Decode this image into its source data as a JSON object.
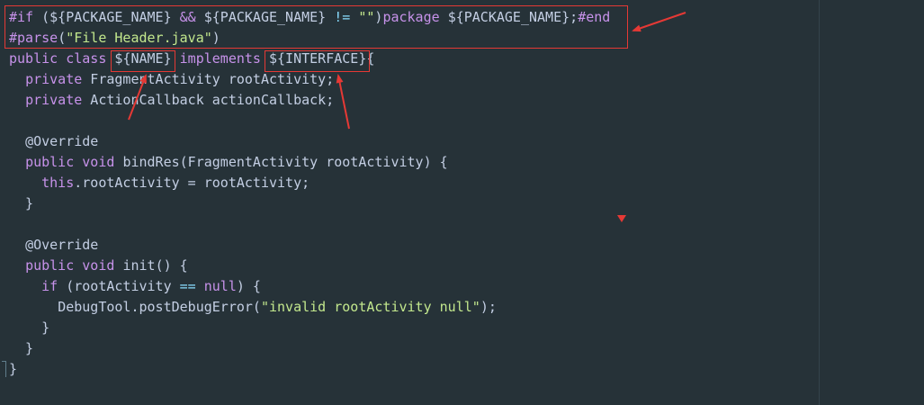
{
  "code": {
    "line1": {
      "if": "#if",
      "open": " (",
      "pkg1": "${PACKAGE_NAME}",
      "and": " && ",
      "pkg2": "${PACKAGE_NAME}",
      "neq": " != ",
      "empty": "\"\"",
      "close": ")",
      "package": "package",
      "sp": " ",
      "pkg3": "${PACKAGE_NAME}",
      "semi": ";",
      "end": "#end"
    },
    "line2": {
      "parse": "#parse",
      "open": "(",
      "arg": "\"File Header.java\"",
      "close": ")"
    },
    "line3": {
      "public": "public",
      "class": " class ",
      "name": "${NAME}",
      "implements": " implements ",
      "iface": "${INTERFACE}",
      "brace": "{"
    },
    "line4": {
      "indent": "  ",
      "private": "private",
      "type": " FragmentActivity ",
      "field": "rootActivity",
      "semi": ";"
    },
    "line5": {
      "indent": "  ",
      "private": "private",
      "type": " ActionCallback ",
      "field": "actionCallback",
      "semi": ";"
    },
    "line7": {
      "indent": "  ",
      "ann": "@Override"
    },
    "line8": {
      "indent": "  ",
      "public": "public",
      "void": " void ",
      "name": "bindRes",
      "params": "(FragmentActivity rootActivity) {"
    },
    "line9": {
      "indent": "    ",
      "this": "this",
      "rest": ".rootActivity = rootActivity;"
    },
    "line10": {
      "text": "  }"
    },
    "line12": {
      "indent": "  ",
      "ann": "@Override"
    },
    "line13": {
      "indent": "  ",
      "public": "public",
      "void": " void ",
      "name": "init",
      "params": "() {"
    },
    "line14": {
      "indent": "    ",
      "if": "if",
      "open": " (rootActivity ",
      "eq": "==",
      "sp": " ",
      "null": "null",
      "close": ") {"
    },
    "line15": {
      "indent": "      ",
      "call": "DebugTool.postDebugError(",
      "arg": "\"invalid rootActivity null\"",
      "close": ");"
    },
    "line16": {
      "text": "    }"
    },
    "line17": {
      "text": "  }"
    },
    "line18": {
      "text": "}"
    }
  },
  "colors": {
    "background": "#263238",
    "keyword": "#c792ea",
    "string": "#c3e88d",
    "operator": "#89ddff",
    "text": "#c3cee3",
    "annotation": "#e53935"
  }
}
